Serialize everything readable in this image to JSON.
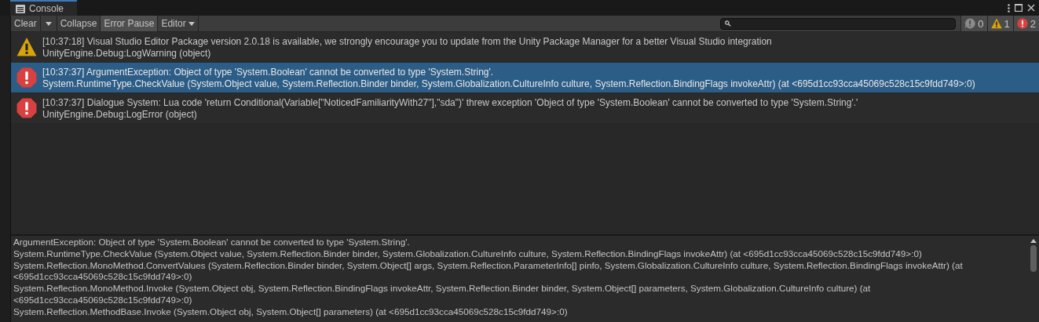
{
  "window": {
    "title": "Console"
  },
  "toolbar": {
    "buttons": [
      {
        "kind": "button",
        "label": "Clear",
        "on": false
      },
      {
        "kind": "dropdown",
        "on": false
      },
      {
        "kind": "button",
        "label": "Collapse",
        "on": false
      },
      {
        "kind": "button",
        "label": "Error Pause",
        "on": true
      },
      {
        "kind": "menu",
        "label": "Editor",
        "on": false
      }
    ],
    "counters": [
      {
        "kind": "info",
        "count": "0"
      },
      {
        "kind": "warning",
        "count": "1"
      },
      {
        "kind": "error",
        "count": "2"
      }
    ]
  },
  "log": [
    {
      "kind": "warning",
      "selected": false,
      "message": "[10:37:18] Visual Studio Editor Package version 2.0.18 is available, we strongly encourage you to update from the Unity Package Manager for a better Visual Studio integration",
      "source": "UnityEngine.Debug:LogWarning (object)"
    },
    {
      "kind": "error",
      "selected": true,
      "message": "[10:37:37] ArgumentException: Object of type 'System.Boolean' cannot be converted to type 'System.String'.",
      "source": "System.RuntimeType.CheckValue (System.Object value, System.Reflection.Binder binder, System.Globalization.CultureInfo culture, System.Reflection.BindingFlags invokeAttr) (at <695d1cc93cca45069c528c15c9fdd749>:0)"
    },
    {
      "kind": "error",
      "selected": false,
      "message": "[10:37:37] Dialogue System: Lua code 'return Conditional(Variable[\"NoticedFamiliarityWith27\"],\"sda\")' threw exception 'Object of type 'System.Boolean' cannot be converted to type 'System.String'.'",
      "source": "UnityEngine.Debug:LogError (object)"
    }
  ],
  "details": [
    "ArgumentException: Object of type 'System.Boolean' cannot be converted to type 'System.String'.",
    "System.RuntimeType.CheckValue (System.Object value, System.Reflection.Binder binder, System.Globalization.CultureInfo culture, System.Reflection.BindingFlags invokeAttr) (at <695d1cc93cca45069c528c15c9fdd749>:0)",
    "System.Reflection.MonoMethod.ConvertValues (System.Reflection.Binder binder, System.Object[] args, System.Reflection.ParameterInfo[] pinfo, System.Globalization.CultureInfo culture, System.Reflection.BindingFlags invokeAttr) (at <695d1cc93cca45069c528c15c9fdd749>:0)",
    "System.Reflection.MonoMethod.Invoke (System.Object obj, System.Reflection.BindingFlags invokeAttr, System.Reflection.Binder binder, System.Object[] parameters, System.Globalization.CultureInfo culture) (at <695d1cc93cca45069c528c15c9fdd749>:0)",
    "System.Reflection.MethodBase.Invoke (System.Object obj, System.Object[] parameters) (at <695d1cc93cca45069c528c15c9fdd749>:0)"
  ]
}
